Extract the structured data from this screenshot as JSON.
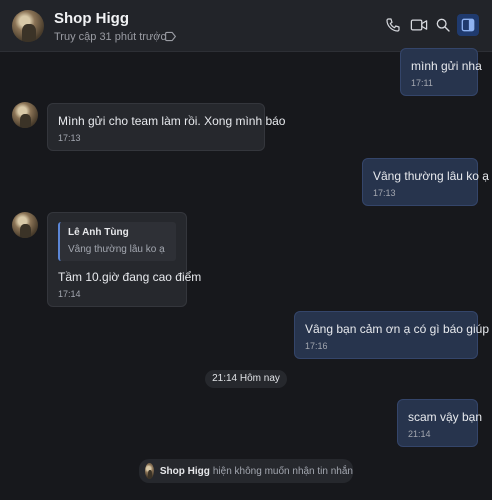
{
  "header": {
    "name": "Shop Higg",
    "status": "Truy cập 31 phút trước",
    "icons": [
      "phone-icon",
      "video-icon",
      "search-icon",
      "sidebar-panel-icon"
    ]
  },
  "messages": [
    {
      "dir": "out",
      "text": "mình gửi nha",
      "time": "17:11"
    },
    {
      "dir": "in",
      "text": "Mình gửi cho team làm rồi. Xong mình báo",
      "time": "17:13"
    },
    {
      "dir": "out",
      "text": "Vâng thường lâu ko ạ",
      "time": "17:13"
    },
    {
      "dir": "in",
      "quote_name": "Lê Anh Tùng",
      "quote_text": "Vâng thường lâu ko ạ",
      "text": "Tầm 10.giờ đang cao điểm",
      "time": "17:14"
    },
    {
      "dir": "out",
      "text": "Vâng bạn cảm ơn ạ có gì báo giúp ạ",
      "time": "17:16"
    },
    {
      "dir": "out",
      "text": "scam vậy bạn",
      "time": "21:14"
    }
  ],
  "date_divider": "21:14 Hôm nay",
  "notice": {
    "name": "Shop Higg",
    "text": "hiện không muốn nhận tin nhắn"
  },
  "colors": {
    "background": "#17181c",
    "header": "#222429",
    "outgoing_bubble": "#27344d",
    "incoming_bubble": "#26282d",
    "accent": "#5b86d6"
  }
}
